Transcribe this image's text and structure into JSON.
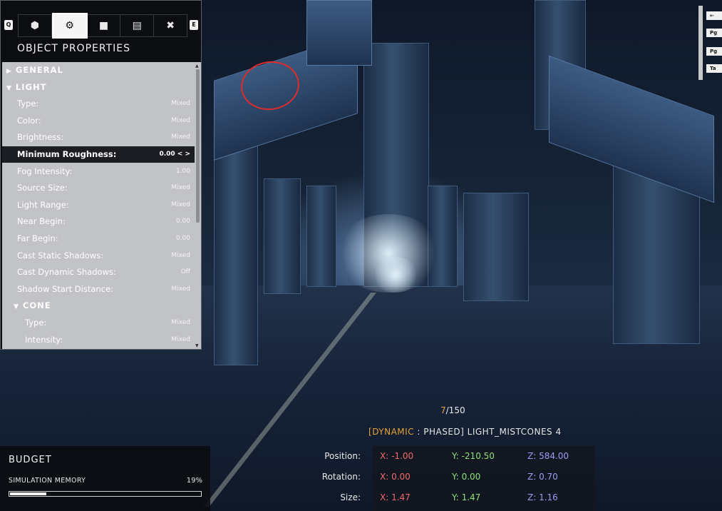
{
  "panel": {
    "title": "OBJECT PROPERTIES",
    "left_key": "Q",
    "right_key": "E",
    "tabs": [
      {
        "icon": "cube-icon",
        "glyph": "⬢"
      },
      {
        "icon": "gear-icon",
        "glyph": "⚙"
      },
      {
        "icon": "folder-icon",
        "glyph": "■"
      },
      {
        "icon": "map-icon",
        "glyph": "▤"
      },
      {
        "icon": "tools-icon",
        "glyph": "✖"
      }
    ],
    "active_tab": 1,
    "properties": [
      {
        "label": "GENERAL",
        "kind": "section",
        "arrow": "▶"
      },
      {
        "label": "LIGHT",
        "kind": "section",
        "arrow": "▼"
      },
      {
        "label": "Type:",
        "value": "Mixed"
      },
      {
        "label": "Color:",
        "value": "Mixed"
      },
      {
        "label": "Brightness:",
        "value": "Mixed"
      },
      {
        "label": "Minimum Roughness:",
        "value": "0.00 < >",
        "selected": true
      },
      {
        "label": "Fog Intensity:",
        "value": "1.00"
      },
      {
        "label": "Source Size:",
        "value": "Mixed"
      },
      {
        "label": "Light Range:",
        "value": "Mixed"
      },
      {
        "label": "Near Begin:",
        "value": "0.00"
      },
      {
        "label": "Far Begin:",
        "value": "0.00"
      },
      {
        "label": "Cast Static Shadows:",
        "value": "Mixed"
      },
      {
        "label": "Cast Dynamic Shadows:",
        "value": "Off"
      },
      {
        "label": "Shadow Start Distance:",
        "value": "Mixed"
      },
      {
        "label": "CONE",
        "kind": "subsection",
        "arrow": "▼"
      },
      {
        "label": "Type:",
        "value": "Mixed",
        "indent": true
      },
      {
        "label": "Intensity:",
        "value": "Mixed",
        "indent": true
      }
    ]
  },
  "key_hints": [
    "←",
    "Pg",
    "Pg",
    "Ta"
  ],
  "object": {
    "index": "7",
    "total": "/150",
    "tag_open": "[",
    "tag_dynamic": "DYNAMIC",
    "tag_rest": " : PHASED] LIGHT_MISTCONES 4"
  },
  "transform": {
    "position": {
      "label": "Position:",
      "x": "X: -1.00",
      "y": "Y: -210.50",
      "z": "Z: 584.00"
    },
    "rotation": {
      "label": "Rotation:",
      "x": "X: 0.00",
      "y": "Y: 0.00",
      "z": "Z: 0.70"
    },
    "size": {
      "label": "Size:",
      "x": "X: 1.47",
      "y": "Y: 1.47",
      "z": "Z: 1.16"
    }
  },
  "budget": {
    "title": "BUDGET",
    "memory_label": "SIMULATION MEMORY",
    "memory_percent": "19%",
    "memory_fraction": 0.19
  },
  "colors": {
    "accent_orange": "#e8a33a",
    "axis_x": "#f06a6a",
    "axis_y": "#8fe07a",
    "axis_z": "#9a9ef2"
  }
}
